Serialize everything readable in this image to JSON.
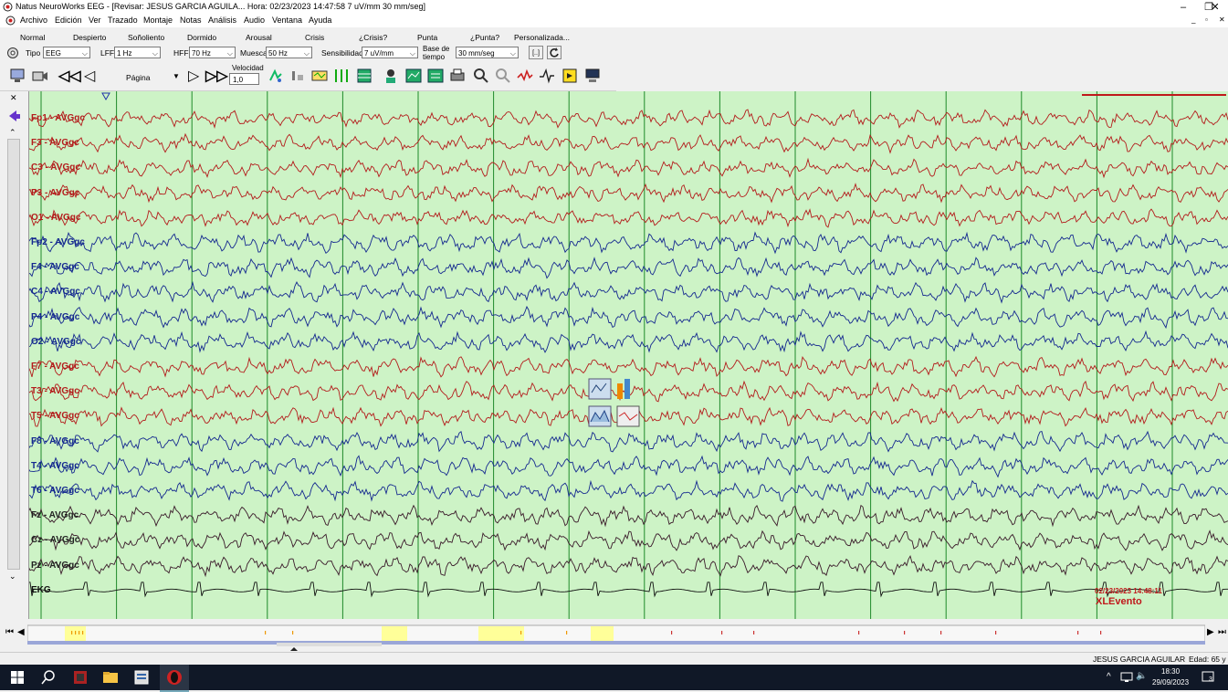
{
  "window": {
    "title": "Natus NeuroWorks EEG - [Revisar:  JESUS  GARCIA AGUILA...  Hora: 02/23/2023 14:47:58  7 uV/mm  30 mm/seg]",
    "controls": [
      "–",
      "❐",
      "✕"
    ]
  },
  "menu": [
    "Archivo",
    "Edición",
    "Ver",
    "Trazado",
    "Montaje",
    "Notas",
    "Análisis",
    "Audio",
    "Ventana",
    "Ayuda"
  ],
  "modes": [
    "Normal",
    "Despierto",
    "Soñoliento",
    "Dormido",
    "Arousal",
    "Crisis",
    "¿Crisis?",
    "Punta",
    "¿Punta?",
    "Personalizada..."
  ],
  "params": {
    "tipo_label": "Tipo",
    "tipo_value": "EEG",
    "lff_label": "LFF",
    "lff_value": "1 Hz",
    "hff_label": "HFF",
    "hff_value": "70 Hz",
    "muesca_label": "Muesca",
    "muesca_value": "50 Hz",
    "sens_label": "Sensibilidad",
    "sens_value": "7 uV/mm",
    "base_label_1": "Base de",
    "base_label_2": "tiempo",
    "base_value": "30 mm/seg",
    "bracket_btn": "[..]"
  },
  "toolbar": {
    "pagina_label": "Página",
    "velocidad_label": "Velocidad",
    "velocidad_value": "1,0",
    "icons": [
      "monitor-icon",
      "video-icon",
      "rewind-icon",
      "step-back-icon",
      "play-icon",
      "fast-forward-icon",
      "marker-icon",
      "event-icon",
      "montage-icon",
      "channels-icon",
      "grid-icon",
      "person-icon",
      "trend-icon",
      "report-icon",
      "print-icon",
      "zoom-in-icon",
      "zoom-out-icon",
      "spike-icon",
      "wave-icon",
      "note-icon",
      "computer-icon"
    ]
  },
  "channels": [
    {
      "label": "Fp1 - AVGgc",
      "color": "#b31b1b"
    },
    {
      "label": "F3 - AVGgc",
      "color": "#b31b1b"
    },
    {
      "label": "C3 - AVGgc",
      "color": "#b31b1b"
    },
    {
      "label": "P3 - AVGgc",
      "color": "#b31b1b"
    },
    {
      "label": "O1 - AVGgc",
      "color": "#b31b1b"
    },
    {
      "label": "Fp2 - AVGgc",
      "color": "#14288f"
    },
    {
      "label": "F4 - AVGgc",
      "color": "#14288f"
    },
    {
      "label": "C4 - AVGgc",
      "color": "#14288f"
    },
    {
      "label": "P4 - AVGgc",
      "color": "#14288f"
    },
    {
      "label": "O2 - AVGgc",
      "color": "#14288f"
    },
    {
      "label": "F7 - AVGgc",
      "color": "#b31b1b"
    },
    {
      "label": "T3 - AVGgc",
      "color": "#b31b1b"
    },
    {
      "label": "T5 - AVGgc",
      "color": "#b31b1b"
    },
    {
      "label": "F8 - AVGgc",
      "color": "#14288f"
    },
    {
      "label": "T4 - AVGgc",
      "color": "#14288f"
    },
    {
      "label": "T6 - AVGgc",
      "color": "#14288f"
    },
    {
      "label": "Fz - AVGgc",
      "color": "#3a1a2a"
    },
    {
      "label": "Cz - AVGgc",
      "color": "#3a1a2a"
    },
    {
      "label": "Pz - AVGgc",
      "color": "#3a1a2a"
    },
    {
      "label": "EKG",
      "color": "#111111"
    }
  ],
  "colors": {
    "eeg_background": "#cdf3c6",
    "gridline": "#1f8a2a",
    "event_red": "#c0181b",
    "timeline_highlight": "#ffff99",
    "taskbar": "#101827"
  },
  "event": {
    "timestamp": "02/23/2023 14:48:11",
    "name": "XLEvento"
  },
  "status": {
    "patient": "JESUS  GARCIA AGUILAR",
    "age": "Edad: 65 y"
  },
  "taskbar": {
    "time": "18:30",
    "date": "29/09/2023",
    "notifications": "3"
  }
}
